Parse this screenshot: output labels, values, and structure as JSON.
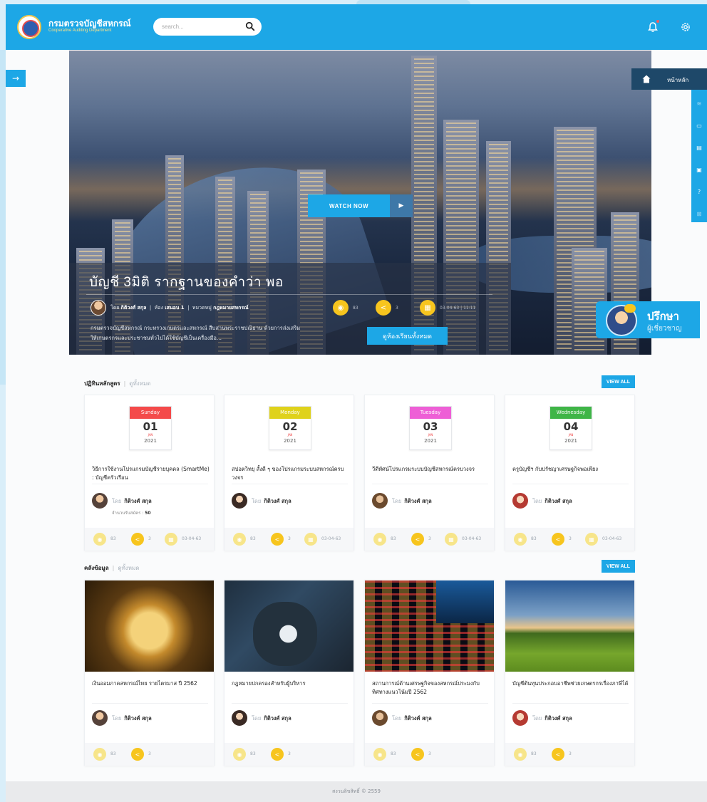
{
  "brand": {
    "name_th": "กรมตรวจบัญชีสหกรณ์",
    "name_en": "Cooperative Auditing Department"
  },
  "search": {
    "placeholder": "search..."
  },
  "sidebar": {
    "toggle_icon": "→"
  },
  "hero": {
    "watch_label": "WATCH NOW",
    "play_icon": "▶",
    "title": "บัญชี 3มิติ รากฐานของคำว่า พอ",
    "meta": {
      "by": "โดย",
      "author": "กิติวงศ์ สกุล",
      "room_label": "ห้อง",
      "room": "เสนอบ 1",
      "category_label": "หมวดหมู่",
      "category": "กฎหมายสหกรณ์"
    },
    "stats": {
      "views": "83",
      "shares": "3",
      "date": "03-04-63 | 11:11"
    },
    "description": "กรมตรวจบัญชีสหกรณ์ กระทรวงเกษตรและสหกรณ์ สืบสานพระราชปณิธาน ด้วยการส่งเสริมให้เกษตรกรและประชาชนทั่วไปได้ใช้บัญชีเป็นเครื่องมือ...",
    "cta_label": "ดูห้องเรียนทั้งหมด"
  },
  "right_nav": {
    "home_label": "หน้าหลัก",
    "rail_icons": [
      "≋",
      "▭",
      "▤",
      "▣",
      "?",
      "⊠"
    ]
  },
  "consult": {
    "title": "ปรึกษา",
    "subtitle": "ผู้เชี่ยวชาญ"
  },
  "courses": {
    "heading": "ปฏิทินหลักสูตร",
    "see_all": "ดูทั้งหมด",
    "view_all": "VIEW ALL",
    "items": [
      {
        "day": "Sunday",
        "date": "01",
        "month": "JAN",
        "year": "2021",
        "color": "#f44a4a",
        "title": "วิธีการใช้งานโปรแกรมบัญชีรายบุคคล (SmartMe) : บัญชีครัวเรือน",
        "by": "โดย",
        "author": "กิติวงศ์ สกุล",
        "enroll_label": "จำนวนรับสมัคร :",
        "enroll": "50",
        "views": "83",
        "shares": "3",
        "date_text": "03-04-63"
      },
      {
        "day": "Monday",
        "date": "02",
        "month": "JAN",
        "year": "2021",
        "color": "#dfd21b",
        "title": "สปอตวิทยุ สั้งดี ๆ ของโปรแกรมระบบสหกรณ์ครบวงจร",
        "by": "โดย",
        "author": "กิติวงศ์ สกุล",
        "views": "83",
        "shares": "3",
        "date_text": "03-04-63"
      },
      {
        "day": "Tuesday",
        "date": "03",
        "month": "JAN",
        "year": "2021",
        "color": "#ee5fd6",
        "title": "วีดีทัศน์โปรแกรมระบบบัญชีสหกรณ์ครบวงจร",
        "by": "โดย",
        "author": "กิติวงศ์ สกุล",
        "views": "83",
        "shares": "3",
        "date_text": "03-04-63"
      },
      {
        "day": "Wednesday",
        "date": "04",
        "month": "JAN",
        "year": "2021",
        "color": "#3fb547",
        "title": "ครูบัญชีฯ กับปรัชญาเศรษฐกิจพอเพียง",
        "by": "โดย",
        "author": "กิติวงศ์ สกุล",
        "views": "83",
        "shares": "3",
        "date_text": "03-04-63"
      }
    ]
  },
  "library": {
    "heading": "คลังข้อมูล",
    "see_all": "ดูทั้งหมด",
    "view_all": "VIEW ALL",
    "items": [
      {
        "title": "เงินออมภาคสหกรณ์ไทย รายไตรมาส ปี 2562",
        "by": "โดย",
        "author": "กิติวงศ์ สกุล",
        "views": "83",
        "shares": "3"
      },
      {
        "title": "กฎหมายปกครองสำหรับผู้บริหาร",
        "by": "โดย",
        "author": "กิติวงศ์ สกุล",
        "views": "83",
        "shares": "3"
      },
      {
        "title": "สถานการณ์ด้านเศรษฐกิจของสหกรณ์ประมงกับทิศทางแนวโน้มปี 2562",
        "by": "โดย",
        "author": "กิติวงศ์ สกุล",
        "views": "83",
        "shares": "3"
      },
      {
        "title": "บัญชีต้นทุนประกอบอาชีพช่วยเกษตรกรเรื่องภาษีได้",
        "by": "โดย",
        "author": "กิติวงศ์ สกุล",
        "views": "83",
        "shares": "3"
      }
    ]
  },
  "footer": {
    "text": "สงวนลิขสิทธิ์ © 2559"
  }
}
